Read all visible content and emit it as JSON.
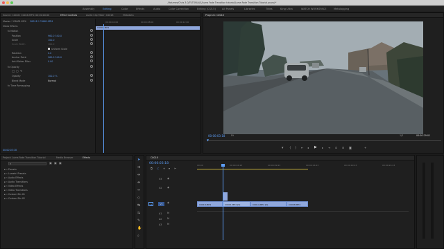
{
  "window": {
    "title": "/Volumes/Chris 3.0/TUTORIALS/Luma Fade Transition tutorial/Luma Fade Transition Tutorial.prproj *"
  },
  "workspaces": [
    "Assembly",
    "Editing",
    "Color",
    "Effects",
    "Audio",
    "Color Correction",
    "Editing (CS5.5)",
    "All Panels",
    "Libraries",
    "Titles",
    "King Ultra",
    "WATCH WORKSPACE",
    "Metalogging"
  ],
  "source_panel": {
    "tabs": [
      "Source: C0018: C0018.MP4: 00:00:00:00",
      "Effect Controls",
      "Audio Clip Mixer: C0018",
      "Metadata"
    ],
    "master_label": "Master * C0001.MP4",
    "sequence_label": "C0018 * C0001.MP4",
    "video_effects_label": "Video Effects",
    "motion_label": "Motion",
    "position_label": "Position",
    "position_value": "960.0    540.0",
    "scale_label": "Scale",
    "scale_value": "100.0",
    "scale_width_label": "Scale Width",
    "scale_width_value": "100.0",
    "uniform_scale_label": "Uniform Scale",
    "rotation_label": "Rotation",
    "rotation_value": "0.0",
    "anchor_label": "Anchor Point",
    "anchor_value": "960.0    540.0",
    "antiflicker_label": "Anti-flicker Filter",
    "antiflicker_value": "0.00",
    "opacity_section_label": "Opacity",
    "opacity_label": "Opacity",
    "opacity_value": "100.0 %",
    "blend_label": "Blend Mode",
    "blend_value": "Normal",
    "time_remap_label": "Time Remapping",
    "clip_bar_label": "C0001.MP4",
    "ruler_labels": [
      "00:00:04:00",
      "00:00:08:00",
      "00:00:12:00"
    ],
    "timecode": "00:00:03:18"
  },
  "program_panel": {
    "tab": "Program: C0018",
    "timecode": "00:00:03:18",
    "fit_label": "Fit",
    "resolution": "1/2",
    "duration": "00:00:29:01"
  },
  "project_panel": {
    "tabs": [
      "Project: Luma Fade Transition Tutorial",
      "Media Browser",
      "Effects"
    ],
    "items": [
      "Presets",
      "Lumetri Presets",
      "Audio Effects",
      "Audio Transitions",
      "Video Effects",
      "Video Transitions",
      "Custom Bin 01",
      "Custom Bin 02"
    ]
  },
  "timeline": {
    "tab": "C0018",
    "timecode": "00:00:03:18",
    "ruler_labels": [
      "00:00",
      "00:00:04:23",
      "00:00:09:23",
      "00:00:14:23",
      "00:00:19:23",
      "00:00:24:23"
    ],
    "tracks": [
      "V3",
      "V2",
      "V1",
      "A1",
      "A2",
      "A3"
    ],
    "clips_v1": [
      "C0018.MP4",
      "C0001.MP4 [V]",
      "C0014.MP4 [V]",
      "C0008.MP4"
    ]
  },
  "colors": {
    "accent": "#5b9cf5",
    "clip_blue": "#8fa7dc",
    "playhead": "#5b9cf5"
  }
}
